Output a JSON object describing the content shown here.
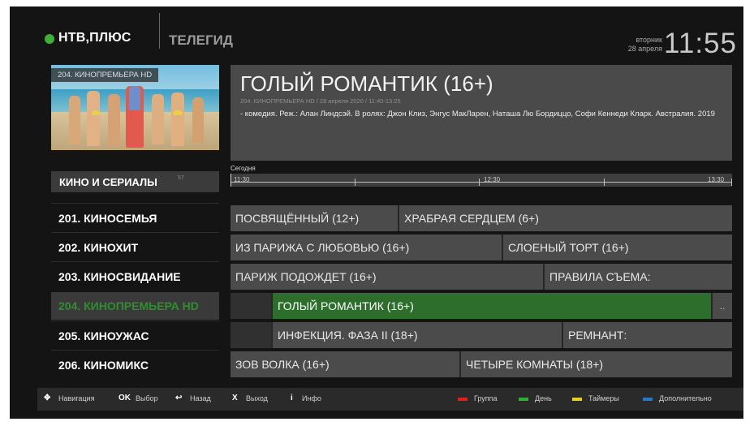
{
  "header": {
    "logo_text": "НТВ,ПЛЮС",
    "section_title": "ТЕЛЕГИД",
    "clock": {
      "weekday": "вторник",
      "date": "28 апреля",
      "time": "11:55"
    }
  },
  "preview": {
    "channel_label": "204. КИНОПРЕМЬЕРА HD"
  },
  "category": {
    "label": "КИНО И СЕРИАЛЫ",
    "count": "57"
  },
  "program_info": {
    "title": "ГОЛЫЙ РОМАНТИК (16+)",
    "meta": "204. КИНОПРЕМЬЕРА HD / 28 апреля 2020 / 11:40-13:25",
    "description": "- комедия.  Реж.: Алан Линдсэй.  В ролях: Джон Клиз, Энгус МакЛарен, Наташа Лю Бордиццо, Софи Кеннеди Кларк. Австралия. 2019"
  },
  "timeline": {
    "today_label": "Сегодня",
    "labels": [
      "11:30",
      "12:30",
      "13:30"
    ]
  },
  "channels": [
    {
      "label": "201. КИНОСЕМЬЯ",
      "active": false
    },
    {
      "label": "202. КИНОХИТ",
      "active": false
    },
    {
      "label": "203. КИНОСВИДАНИЕ",
      "active": false
    },
    {
      "label": "204. КИНОПРЕМЬЕРА HD",
      "active": true
    },
    {
      "label": "205. КИНОУЖАС",
      "active": false
    },
    {
      "label": "206. КИНОМИКС",
      "active": false
    }
  ],
  "schedule": [
    [
      {
        "title": "ПОСВЯЩЁННЫЙ (12+)"
      },
      {
        "title": "ХРАБРАЯ СЕРДЦЕМ (6+)"
      }
    ],
    [
      {
        "title": "ИЗ ПАРИЖА С ЛЮБОВЬЮ (16+)"
      },
      {
        "title": "СЛОЕНЫЙ ТОРТ (16+)"
      }
    ],
    [
      {
        "title": "ПАРИЖ ПОДОЖДЕТ (16+)"
      },
      {
        "title": "ПРАВИЛА СЪЕМА:"
      }
    ],
    [
      {
        "title": ""
      },
      {
        "title": "ГОЛЫЙ РОМАНТИК (16+)",
        "selected": true
      },
      {
        "title": ".."
      }
    ],
    [
      {
        "title": ""
      },
      {
        "title": "ИНФЕКЦИЯ. ФАЗА II (18+)"
      },
      {
        "title": "РЕМНАНТ:"
      }
    ],
    [
      {
        "title": "ЗОВ ВОЛКА (16+)"
      },
      {
        "title": "ЧЕТЫРЕ КОМНАТЫ (18+)"
      }
    ]
  ],
  "footer": {
    "hints": [
      {
        "key": "✥",
        "label": "Навигация"
      },
      {
        "key": "OK",
        "label": "Выбор"
      },
      {
        "key": "↩",
        "label": "Назад"
      },
      {
        "key": "X",
        "label": "Выход"
      },
      {
        "key": "i",
        "label": "Инфо"
      }
    ],
    "color_keys": [
      {
        "color": "#e02020",
        "label": "Группа"
      },
      {
        "color": "#2fae2f",
        "label": "День"
      },
      {
        "color": "#e6d21e",
        "label": "Таймеры"
      },
      {
        "color": "#2a78c8",
        "label": "Дополнительно"
      }
    ]
  },
  "colors": {
    "accent_green": "#2d6e2d",
    "active_channel_text": "#2e8f2e",
    "background": "#141414"
  }
}
